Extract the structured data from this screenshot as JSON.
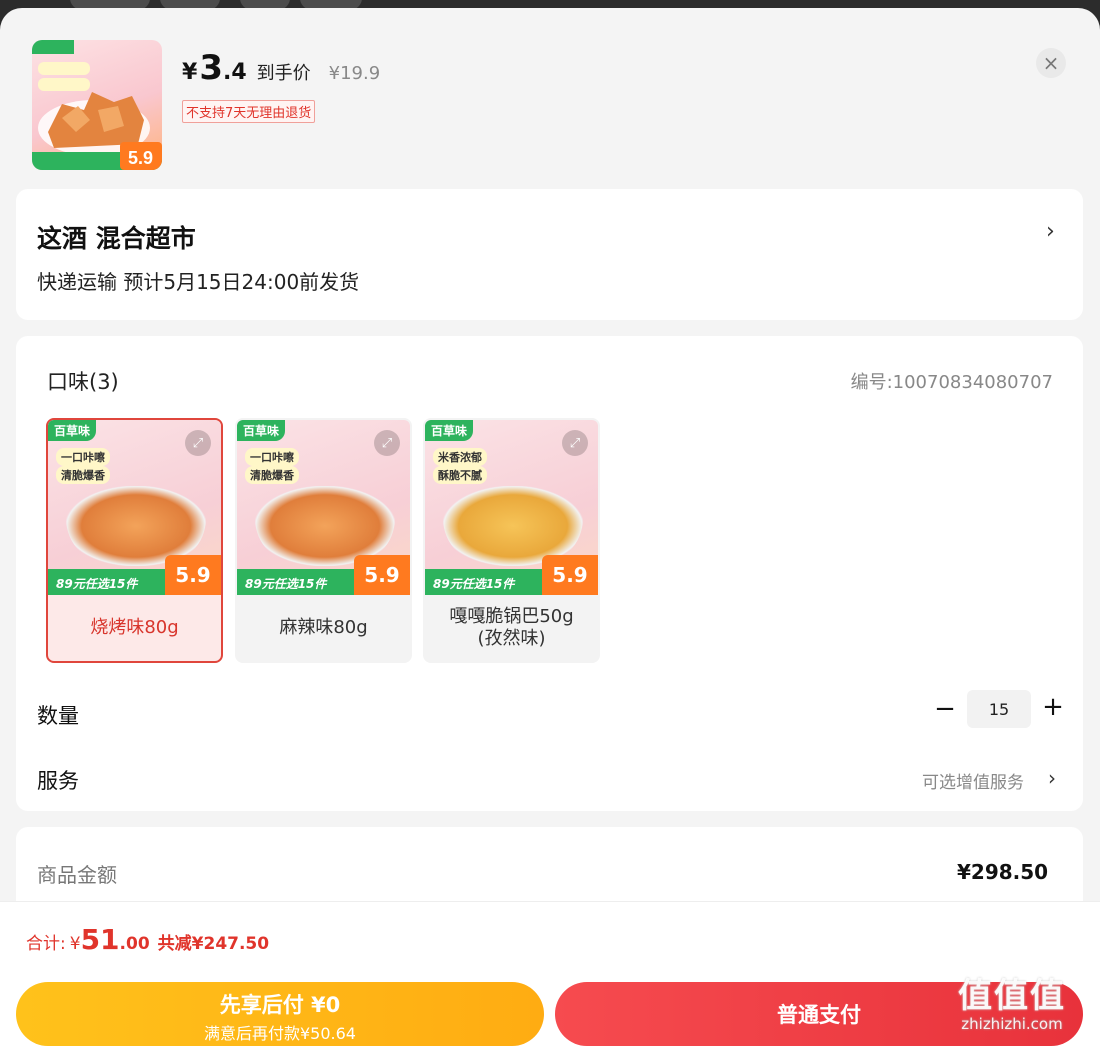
{
  "header": {
    "yen": "¥",
    "price_int": "3",
    "price_dec": ".4",
    "price_tag": "到手价",
    "original_price": "¥19.9",
    "no_return_notice": "不支持7天无理由退货",
    "close_icon": "close-icon"
  },
  "shipping": {
    "store": "这酒  混合超市",
    "delivery": "快递运输 预计5月15日24:00前发货"
  },
  "options": {
    "title": "口味(3)",
    "sku": "编号:10070834080707",
    "items": [
      {
        "label": "烧烤味80g",
        "selected": true,
        "brand": "百草味",
        "tag1": "一口咔嚓",
        "tag2": "清脆爆香",
        "banner": "89元任选15件",
        "badge": "5.9"
      },
      {
        "label": "麻辣味80g",
        "selected": false,
        "brand": "百草味",
        "tag1": "一口咔嚓",
        "tag2": "清脆爆香",
        "banner": "89元任选15件",
        "badge": "5.9"
      },
      {
        "label": "嘎嘎脆锅巴50g\n(孜然味)",
        "selected": false,
        "brand": "百草味",
        "tag1": "米香浓郁",
        "tag2": "酥脆不腻",
        "banner": "89元任选15件",
        "badge": "5.9"
      }
    ],
    "quantity_label": "数量",
    "quantity": "15",
    "minus": "−",
    "plus": "+",
    "service_label": "服务",
    "service_option": "可选增值服务"
  },
  "amount": {
    "label": "商品金额",
    "value": "¥298.50"
  },
  "footer": {
    "total_label": "合计:",
    "total_yen": "¥",
    "total_int": "51",
    "total_dec": ".00",
    "total_save": "共减¥247.50",
    "later_line1": "先享后付 ¥0",
    "later_line2": "满意后再付款¥50.64",
    "pay_label": "普通支付"
  },
  "watermark": {
    "line1": "值值值",
    "line2": "zhizhizhi.com"
  },
  "colors": {
    "accent_red": "#e0342b",
    "brand_green": "#2db35d",
    "later_yellow": "#ffb51a",
    "pay_red": "#ee3c42"
  }
}
